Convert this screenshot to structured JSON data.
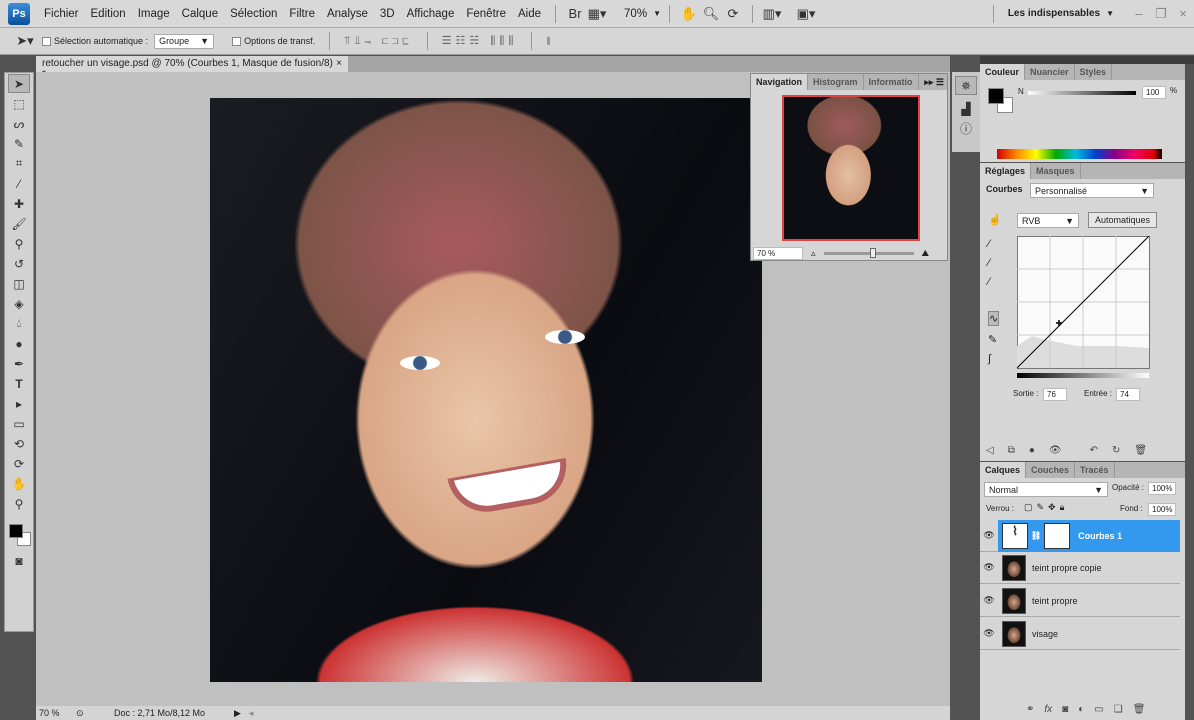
{
  "app": {
    "logo": "Ps",
    "menu": [
      "Fichier",
      "Edition",
      "Image",
      "Calque",
      "Sélection",
      "Filtre",
      "Analyse",
      "3D",
      "Affichage",
      "Fenêtre",
      "Aide"
    ],
    "zoom": "70%",
    "workspace": "Les indispensables"
  },
  "options": {
    "auto_select_label": "Sélection automatique :",
    "auto_select_value": "Groupe",
    "transform_label": "Options de transf."
  },
  "document": {
    "tab_title": "retoucher un visage.psd @ 70% (Courbes 1, Masque de fusion/8) *",
    "close": "×"
  },
  "status": {
    "zoom": "70 %",
    "doc_info": "Doc : 2,71 Mo/8,12 Mo"
  },
  "navigator": {
    "tabs": [
      "Navigation",
      "Histogram",
      "Informatio"
    ],
    "zoom": "70 %"
  },
  "color_panel": {
    "tabs": [
      "Couleur",
      "Nuancier",
      "Styles"
    ],
    "channel": "N",
    "value": "100",
    "unit": "%"
  },
  "adjust_panel": {
    "tabs": [
      "Réglages",
      "Masques"
    ],
    "type": "Courbes",
    "preset": "Personnalisé",
    "channel": "RVB",
    "auto_button": "Automatiques",
    "output_label": "Sortie :",
    "output": "76",
    "input_label": "Entrée :",
    "input": "74"
  },
  "layers_panel": {
    "tabs": [
      "Calques",
      "Couches",
      "Tracés"
    ],
    "blend_mode": "Normal",
    "opacity_label": "Opacité :",
    "opacity": "100%",
    "lock_label": "Verrou :",
    "fill_label": "Fond :",
    "fill": "100%",
    "layers": [
      {
        "name": "Courbes 1"
      },
      {
        "name": "teint propre copie"
      },
      {
        "name": "teint propre"
      },
      {
        "name": "visage"
      }
    ]
  },
  "colors": {
    "accent": "#3399ee"
  }
}
